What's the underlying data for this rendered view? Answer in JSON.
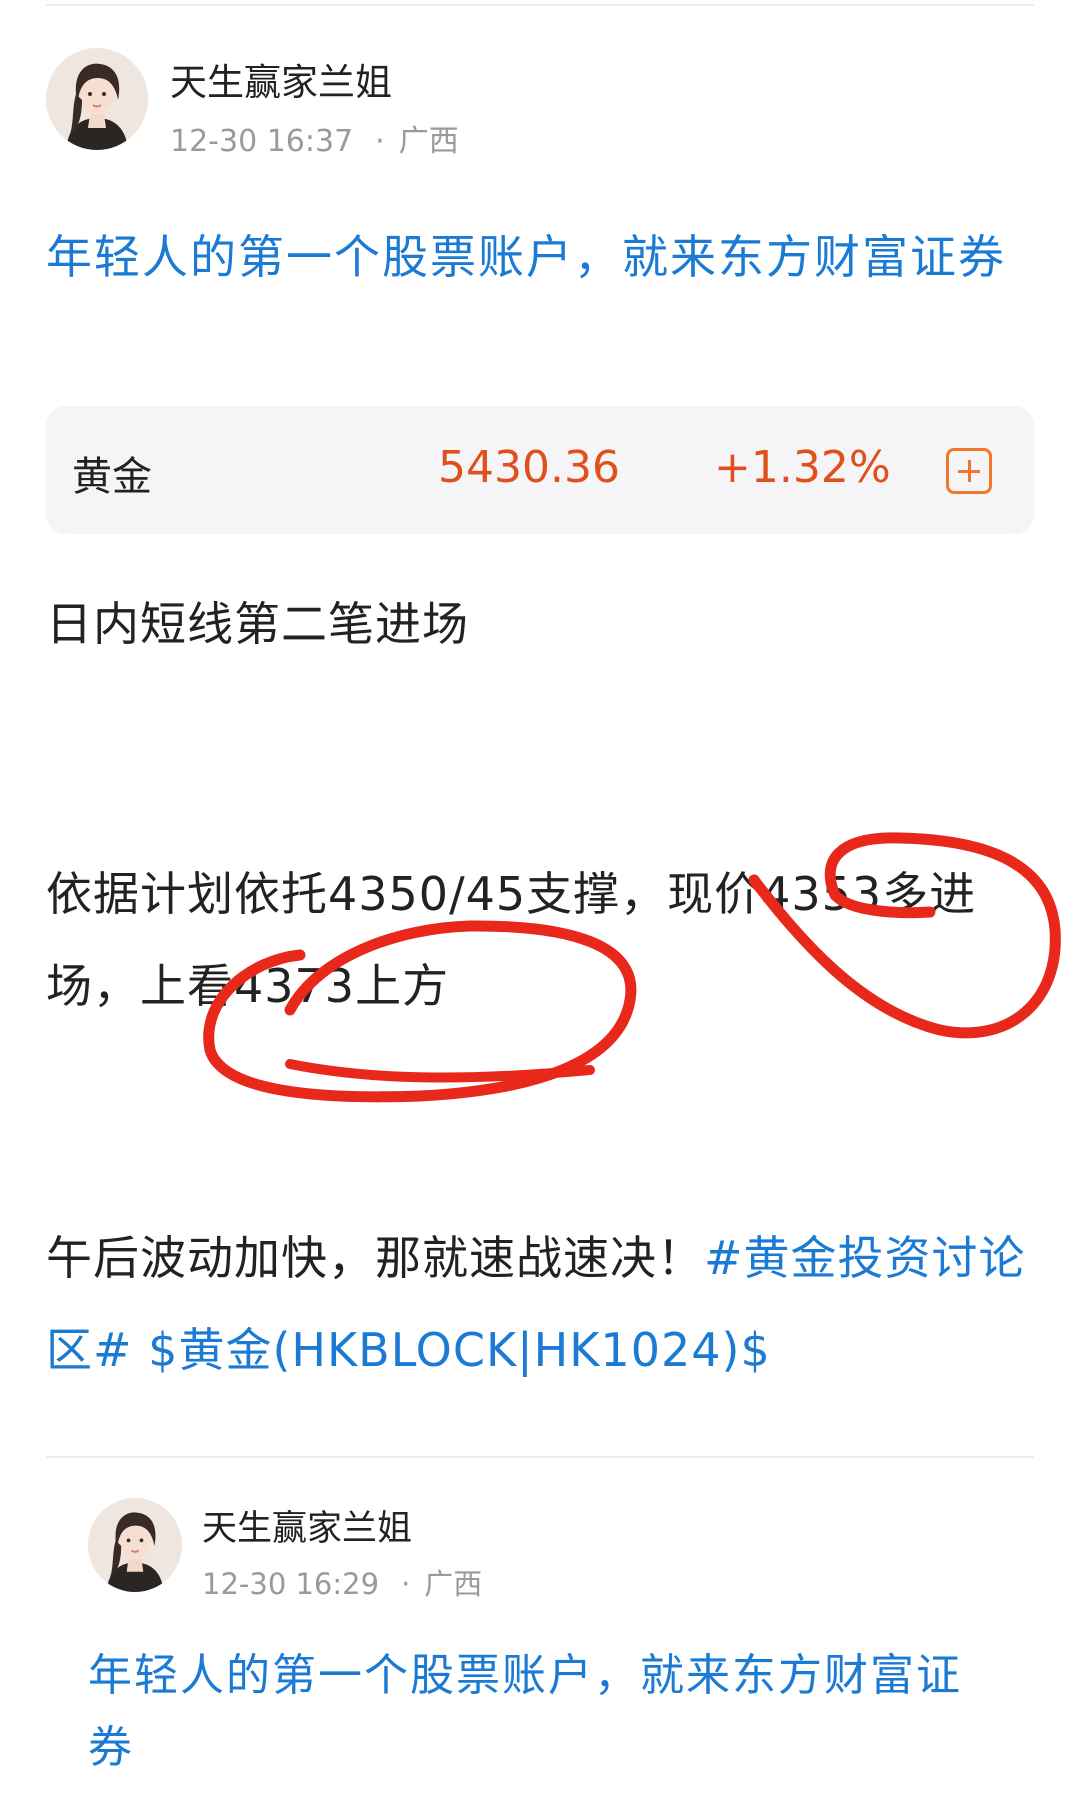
{
  "post": {
    "author": "天生赢家兰姐",
    "time": "12-30 16:37",
    "location": "广西",
    "ad_link": "年轻人的第一个股票账户，就来东方财富证券",
    "stock": {
      "name": "黄金",
      "price": "5430.36",
      "change": "+1.32%"
    },
    "paragraph1": "日内短线第二笔进场",
    "paragraph2": "依据计划依托4350/45支撑，现价4353多进场，上看4373上方",
    "paragraph3_text": "午后波动加快，那就速战速决！",
    "topic_tag": "#黄金投资讨论区#",
    "stock_tag": "$黄金(HKBLOCK|HK1024)$"
  },
  "quoted_post": {
    "author": "天生赢家兰姐",
    "time": "12-30 16:29",
    "location": "广西",
    "ad_link": "年轻人的第一个股票账户，就来东方财富证券"
  },
  "icons": {
    "add": "plus-square-icon",
    "meta_separator": "·"
  },
  "colors": {
    "link_blue": "#1a7ad4",
    "price_red": "#e0501d",
    "add_orange": "#f0772b",
    "annotation_red": "#e8281b"
  }
}
